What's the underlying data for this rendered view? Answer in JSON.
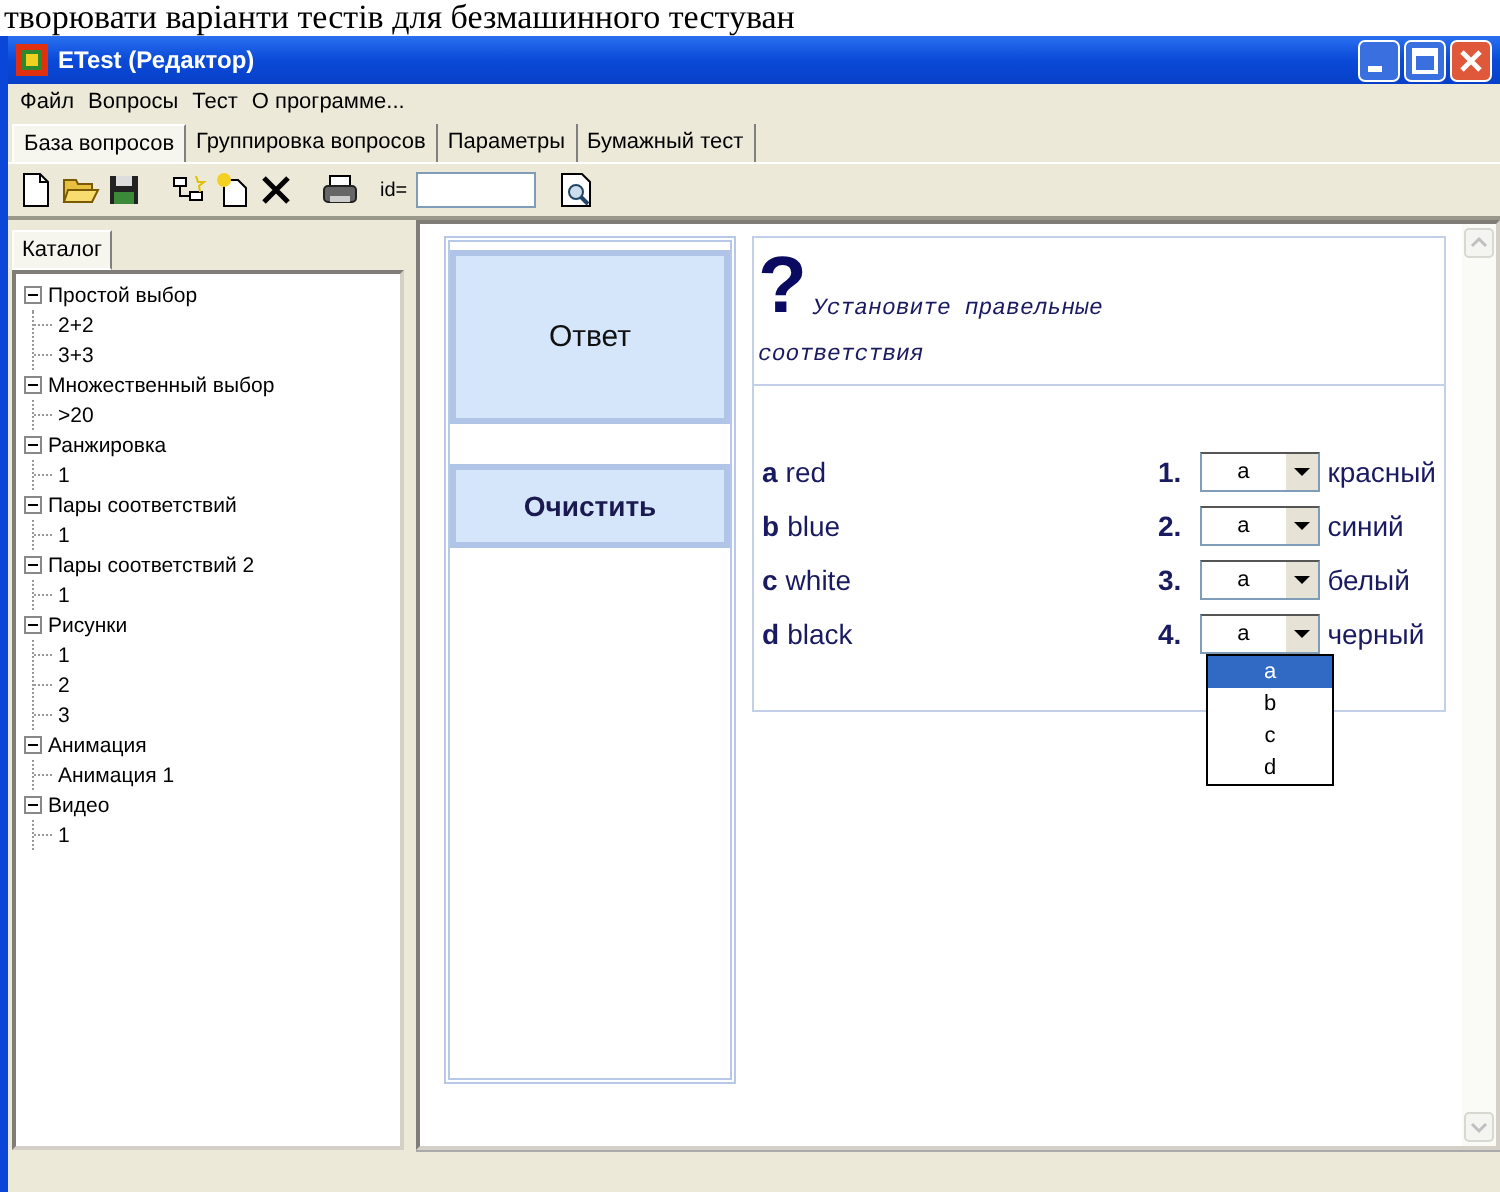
{
  "document_caption": "творювати варіанти тестів для безмашинного тестуван",
  "window": {
    "title": "ETest (Редактор)"
  },
  "menu": [
    "Файл",
    "Вопросы",
    "Тест",
    "О программе..."
  ],
  "tabs": [
    {
      "label": "База вопросов",
      "selected": true
    },
    {
      "label": "Группировка вопросов",
      "selected": false
    },
    {
      "label": "Параметры",
      "selected": false
    },
    {
      "label": "Бумажный тест",
      "selected": false
    }
  ],
  "toolbar": {
    "id_label": "id="
  },
  "catalog": {
    "tab": "Каталог",
    "tree": [
      {
        "label": "Простой выбор",
        "expanded": true,
        "children": [
          {
            "label": "2+2"
          },
          {
            "label": "3+3"
          }
        ]
      },
      {
        "label": "Множественный выбор",
        "expanded": true,
        "children": [
          {
            "label": ">20"
          }
        ]
      },
      {
        "label": "Ранжировка",
        "expanded": true,
        "children": [
          {
            "label": "1"
          }
        ]
      },
      {
        "label": "Пары соответствий",
        "expanded": true,
        "children": [
          {
            "label": "1"
          }
        ]
      },
      {
        "label": "Пары соответствий 2",
        "expanded": true,
        "children": [
          {
            "label": "1"
          }
        ]
      },
      {
        "label": "Рисунки",
        "expanded": true,
        "children": [
          {
            "label": "1"
          },
          {
            "label": "2"
          },
          {
            "label": "3"
          }
        ]
      },
      {
        "label": "Анимация",
        "expanded": true,
        "children": [
          {
            "label": "Анимация 1"
          }
        ]
      },
      {
        "label": "Видео",
        "expanded": true,
        "children": [
          {
            "label": "1"
          }
        ]
      }
    ]
  },
  "buttons": [
    "Ответ",
    "Очистить"
  ],
  "question": {
    "mark": "?",
    "text_line1": "Установите правельные",
    "text_line2": "соответствия",
    "left": [
      {
        "letter": "a",
        "word": "red"
      },
      {
        "letter": "b",
        "word": "blue"
      },
      {
        "letter": "c",
        "word": "white"
      },
      {
        "letter": "d",
        "word": "black"
      }
    ],
    "right": [
      {
        "number": "1.",
        "value": "a",
        "word": "красный"
      },
      {
        "number": "2.",
        "value": "a",
        "word": "синий"
      },
      {
        "number": "3.",
        "value": "a",
        "word": "белый"
      },
      {
        "number": "4.",
        "value": "a",
        "word": "черный"
      }
    ],
    "dropdown_list": [
      {
        "label": "a",
        "selected": true
      },
      {
        "label": "b",
        "selected": false
      },
      {
        "label": "c",
        "selected": false
      },
      {
        "label": "d",
        "selected": false
      }
    ]
  }
}
